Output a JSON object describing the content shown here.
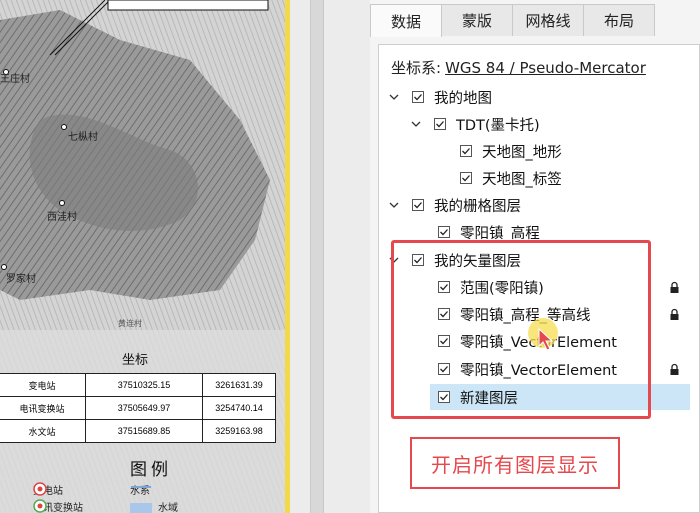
{
  "map": {
    "villages": [
      "王庄村",
      "七枞村",
      "西洼村",
      "罗家村",
      "黄连村"
    ],
    "coord_title": "坐标",
    "coord_table": [
      [
        "变电站",
        "37510325.15",
        "3261631.39"
      ],
      [
        "电讯变换站",
        "37505649.97",
        "3254740.14"
      ],
      [
        "水文站",
        "37515689.85",
        "3259163.98"
      ]
    ],
    "legend_title": "图例",
    "legend": [
      {
        "label": "变电站"
      },
      {
        "label": "水系"
      },
      {
        "label": "电讯变换站"
      },
      {
        "label": "水域"
      }
    ]
  },
  "panel": {
    "tabs": [
      {
        "label": "数据",
        "active": true
      },
      {
        "label": "蒙版",
        "active": false
      },
      {
        "label": "网格线",
        "active": false
      },
      {
        "label": "布局",
        "active": false
      }
    ],
    "crs_label": "坐标系:",
    "crs_value": "WGS 84 / Pseudo-Mercator",
    "tree": [
      {
        "label": "我的地图",
        "level": 0,
        "chevron": "down"
      },
      {
        "label": "TDT(墨卡托)",
        "level": 1,
        "chevron": "down"
      },
      {
        "label": "天地图_地形",
        "level": 2
      },
      {
        "label": "天地图_标签",
        "level": 2
      },
      {
        "label": "我的栅格图层",
        "level": 0,
        "chevron": "down"
      },
      {
        "label": "零阳镇_高程",
        "level": 1
      },
      {
        "label": "我的矢量图层",
        "level": 0,
        "chevron": "down"
      },
      {
        "label": "范围(零阳镇)",
        "level": 1,
        "locked": true
      },
      {
        "label": "零阳镇_高程_等高线",
        "level": 1,
        "locked": true
      },
      {
        "label": "零阳镇_VectorElement",
        "level": 1
      },
      {
        "label": "零阳镇_VectorElement",
        "level": 1,
        "locked": true
      },
      {
        "label": "新建图层",
        "level": 1,
        "selected": true
      }
    ]
  },
  "annotation": {
    "callout": "开启所有图层显示",
    "highlight_color": "#e5484d"
  }
}
